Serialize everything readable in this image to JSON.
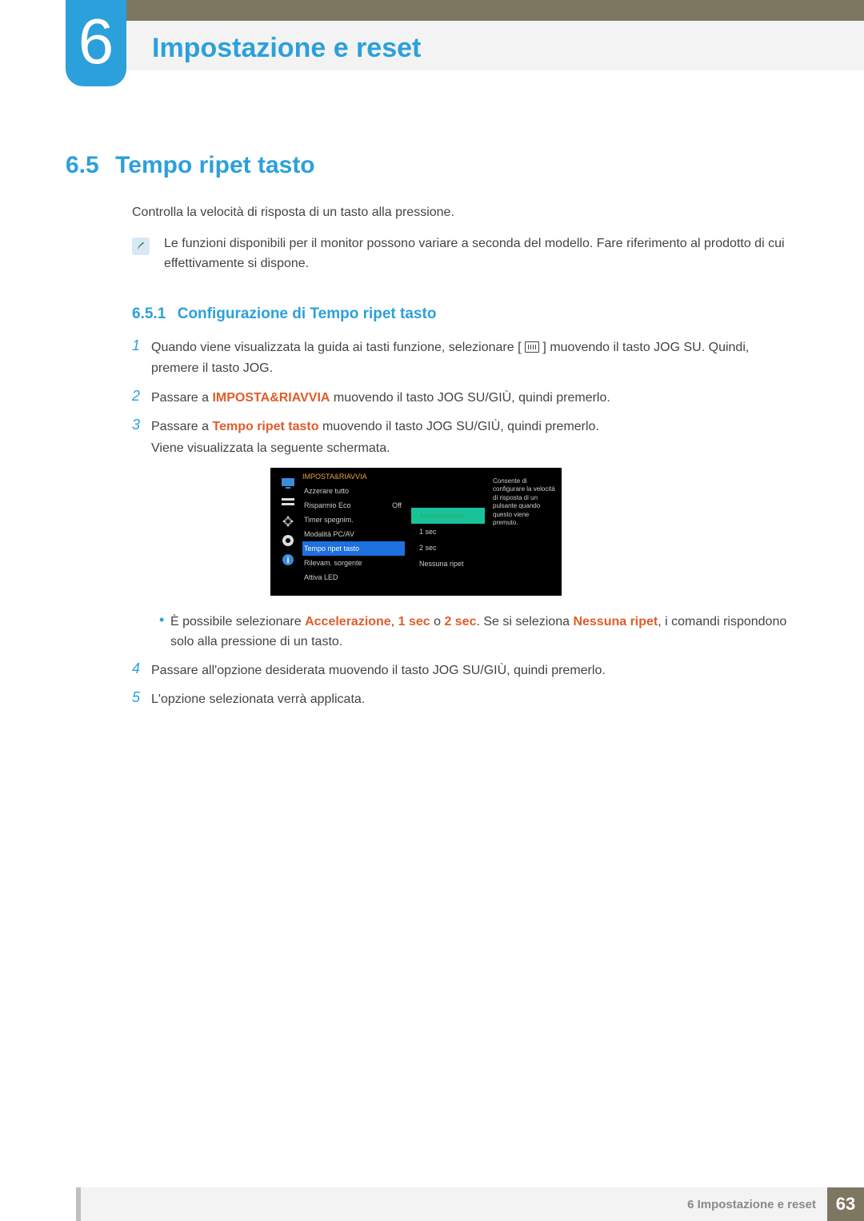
{
  "chapter": {
    "number": "6",
    "title": "Impostazione e reset"
  },
  "section": {
    "number": "6.5",
    "title": "Tempo ripet tasto"
  },
  "intro": "Controlla la velocità di risposta di un tasto alla pressione.",
  "note": "Le funzioni disponibili per il monitor possono variare a seconda del modello. Fare riferimento al prodotto di cui effettivamente si dispone.",
  "subsection": {
    "number": "6.5.1",
    "title": "Configurazione di Tempo ripet tasto"
  },
  "steps": {
    "s1a": "Quando viene visualizzata la guida ai tasti funzione, selezionare [",
    "s1b": "] muovendo il tasto JOG SU. Quindi, premere il tasto JOG.",
    "s2a": "Passare a ",
    "s2_hl": "IMPOSTA&RIAVVIA",
    "s2b": " muovendo il tasto JOG SU/GIÙ, quindi premerlo.",
    "s3a": "Passare a ",
    "s3_hl": "Tempo ripet tasto",
    "s3b": " muovendo il tasto JOG SU/GIÙ, quindi premerlo.",
    "s3c": "Viene visualizzata la seguente schermata.",
    "bullet_a": "È possibile selezionare ",
    "bullet_hl1": "Accelerazione",
    "bullet_mid1": ", ",
    "bullet_hl2": "1 sec",
    "bullet_mid2": " o ",
    "bullet_hl3": "2 sec",
    "bullet_b": ". Se si seleziona ",
    "bullet_hl4": "Nessuna ripet",
    "bullet_c": ", i comandi rispondono solo alla pressione di un tasto.",
    "s4": "Passare all'opzione desiderata muovendo il tasto JOG SU/GIÙ, quindi premerlo.",
    "s5": "L'opzione selezionata verrà applicata."
  },
  "osd": {
    "title": "IMPOSTA&RIAVVIA",
    "items": [
      {
        "label": "Azzerare tutto",
        "value": ""
      },
      {
        "label": "Risparmio Eco",
        "value": "Off"
      },
      {
        "label": "Timer spegnim.",
        "value": ""
      },
      {
        "label": "Modalità PC/AV",
        "value": ""
      },
      {
        "label": "Tempo ripet tasto",
        "value": ""
      },
      {
        "label": "Rilevam. sorgente",
        "value": ""
      },
      {
        "label": "Attiva LED",
        "value": ""
      }
    ],
    "submenu": [
      "Accelerazione",
      "1 sec",
      "2 sec",
      "Nessuna ripet"
    ],
    "description": "Consente di configurare la velocità di risposta di un pulsante quando questo viene premuto."
  },
  "footer": {
    "chapter_label": "6 Impostazione e reset",
    "page": "63"
  }
}
